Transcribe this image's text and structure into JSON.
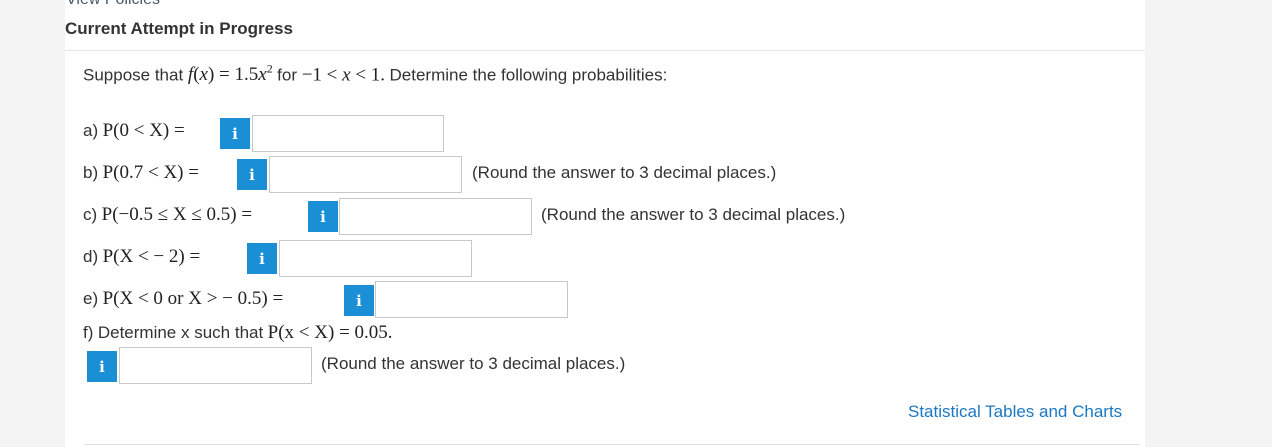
{
  "header": {
    "cut_link_text": "View Policies",
    "section_title": "Current Attempt in Progress"
  },
  "question": {
    "intro_prefix": "Suppose that ",
    "intro_suffix": "Determine the following probabilities:",
    "parts": [
      {
        "label": "a)",
        "expr": "P(0 < X) =",
        "note": ""
      },
      {
        "label": "b)",
        "expr": "P(0.7 < X) =",
        "note": "(Round the answer to 3 decimal places.)"
      },
      {
        "label": "c)",
        "expr": "P(−0.5 ≤ X ≤ 0.5) =",
        "note": "(Round the answer to 3 decimal places.)"
      },
      {
        "label": "d)",
        "expr": "P(X <  − 2) =",
        "note": ""
      },
      {
        "label": "e)",
        "expr": "P(X < 0 or X >  − 0.5) =",
        "note": ""
      },
      {
        "label": "f)",
        "prompt": "Determine x such that",
        "expr": "P(x < X) = 0.05.",
        "note": "(Round the answer to 3 decimal places.)"
      }
    ],
    "info_glyph": "i"
  },
  "footer": {
    "tables_link": "Statistical Tables and Charts"
  }
}
